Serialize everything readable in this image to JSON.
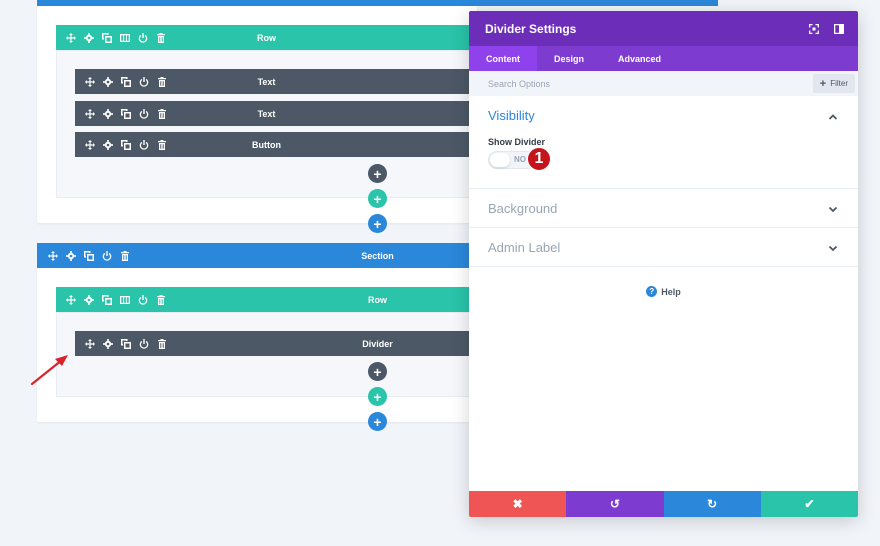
{
  "builder": {
    "row1": {
      "label": "Row",
      "modules": [
        {
          "label": "Text"
        },
        {
          "label": "Text"
        },
        {
          "label": "Button"
        }
      ]
    },
    "section2": {
      "label": "Section",
      "row": {
        "label": "Row",
        "modules": [
          {
            "label": "Divider"
          }
        ]
      }
    },
    "add_symbol": "+"
  },
  "panel": {
    "title": "Divider Settings",
    "tabs": [
      {
        "label": "Content",
        "active": true
      },
      {
        "label": "Design",
        "active": false
      },
      {
        "label": "Advanced",
        "active": false
      }
    ],
    "search_placeholder": "Search Options",
    "filter_label": "Filter",
    "filter_symbol": "+",
    "sections": {
      "visibility": {
        "title": "Visibility",
        "field_label": "Show Divider",
        "toggle_value": "NO",
        "badge": "1"
      },
      "background": {
        "title": "Background"
      },
      "admin_label": {
        "title": "Admin Label"
      }
    },
    "help_label": "Help",
    "help_symbol": "?",
    "footer": {
      "cancel_symbol": "✖",
      "undo_symbol": "↺",
      "redo_symbol": "↻",
      "save_symbol": "✔"
    }
  },
  "colors": {
    "section_blue": "#2b87da",
    "row_teal": "#29c4a9",
    "module_dark": "#4c5866",
    "panel_purple": "#6c2eb9",
    "tab_purple": "#7e3bd0",
    "cancel_red": "#ef5555",
    "save_green": "#29c4a9",
    "arrow_red": "#d8232a"
  }
}
